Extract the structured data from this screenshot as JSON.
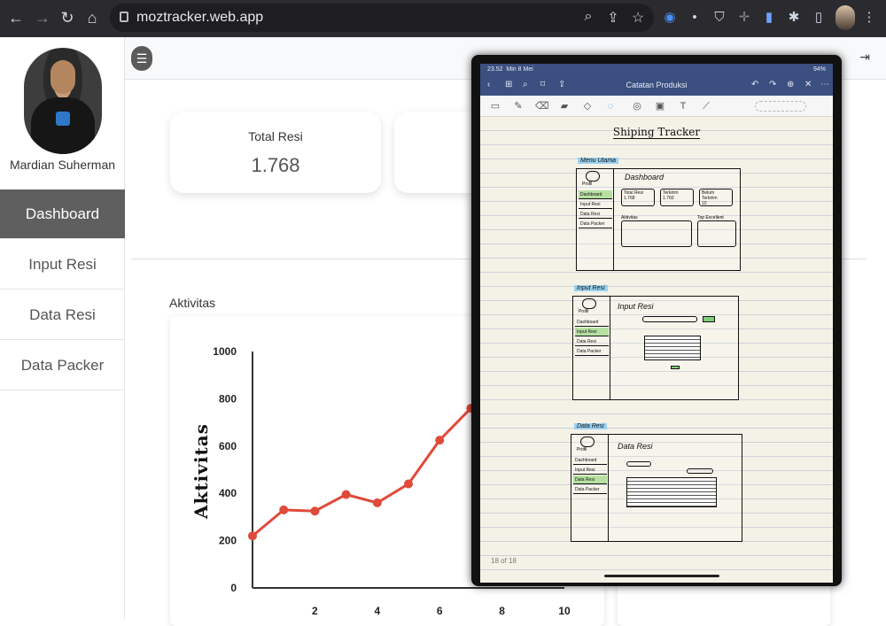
{
  "browser": {
    "url": "moztracker.web.app",
    "nav_icons": [
      "back-arrow-icon",
      "forward-arrow-icon",
      "reload-icon",
      "home-icon"
    ],
    "omnibox_icons": [
      "zoom-icon",
      "share-icon",
      "star-icon"
    ],
    "extension_icons": [
      "extension-blue-icon",
      "extension-dot-icon",
      "extension-shield-icon",
      "extension-cross-icon",
      "extension-file-icon",
      "puzzle-icon",
      "sidebar-icon"
    ]
  },
  "sidebar": {
    "user_name": "Mardian Suherman",
    "items": [
      {
        "label": "Dashboard",
        "active": true
      },
      {
        "label": "Input Resi",
        "active": false
      },
      {
        "label": "Data Resi",
        "active": false
      },
      {
        "label": "Data Packer",
        "active": false
      }
    ]
  },
  "cards": [
    {
      "title": "Total Resi",
      "value": "1.768"
    }
  ],
  "section": {
    "label": "Aktivitas"
  },
  "chart_data": {
    "type": "line",
    "title": "",
    "xlabel": "",
    "ylabel": "Aktivitas",
    "x": [
      0,
      1,
      2,
      3,
      4,
      5,
      6,
      7
    ],
    "series": [
      {
        "values": [
          220,
          330,
          325,
          395,
          360,
          440,
          625,
          760
        ]
      }
    ],
    "xticks": [
      "2",
      "4",
      "6",
      "8",
      "10"
    ],
    "yticks": [
      "0",
      "200",
      "400",
      "600",
      "800",
      "1000"
    ],
    "xlim": [
      0,
      10
    ],
    "ylim": [
      0,
      1000
    ],
    "line_color": "#e04a3a",
    "grid": false
  },
  "overlay": {
    "status_time": "23.52",
    "status_date": "Min 8 Mei",
    "battery": "94%",
    "title": "Catatan Produksi",
    "page_count": "18 of 18",
    "sketch_title": "Shiping Tracker",
    "sections": [
      {
        "label": "Menu Utama",
        "heading": "Dashboard",
        "profile": "Profil",
        "menu": [
          "Dashboard",
          "Input Resi",
          "Data Resi",
          "Data Packer"
        ],
        "boxes": [
          {
            "title": "Total Resi",
            "value": "1.768"
          },
          {
            "title": "Terkirim",
            "value": "1.760"
          },
          {
            "title": "Belum Terkirim",
            "value": "10"
          }
        ],
        "chart_label": "Aktivitas",
        "list_label": "Top Excellent"
      },
      {
        "label": "Input Resi",
        "heading": "Input Resi",
        "profile": "Profil",
        "menu": [
          "Dashboard",
          "Input Resi",
          "Data Resi",
          "Data Packer"
        ]
      },
      {
        "label": "Data Resi",
        "heading": "Data Resi",
        "profile": "Profil",
        "menu": [
          "Dashboard",
          "Input Resi",
          "Data Resi",
          "Data Packer"
        ]
      }
    ]
  },
  "colors": {
    "chrome": "#2b2b2f",
    "active_menu": "#5f5f5f",
    "overlay_bar": "#3b4f80",
    "highlight": "#9ad1f0",
    "green": "#b6e0a2"
  }
}
